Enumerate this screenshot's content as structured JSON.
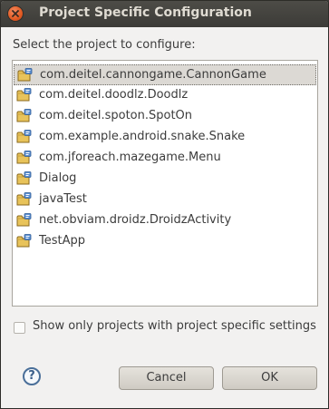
{
  "window": {
    "title": "Project Specific Configuration"
  },
  "prompt": "Select the project to configure:",
  "projects": [
    {
      "name": "com.deitel.cannongame.CannonGame",
      "selected": true
    },
    {
      "name": "com.deitel.doodlz.Doodlz",
      "selected": false
    },
    {
      "name": "com.deitel.spoton.SpotOn",
      "selected": false
    },
    {
      "name": "com.example.android.snake.Snake",
      "selected": false
    },
    {
      "name": "com.jforeach.mazegame.Menu",
      "selected": false
    },
    {
      "name": "Dialog",
      "selected": false
    },
    {
      "name": "javaTest",
      "selected": false
    },
    {
      "name": "net.obviam.droidz.DroidzActivity",
      "selected": false
    },
    {
      "name": "TestApp",
      "selected": false
    }
  ],
  "filter": {
    "label": "Show only projects with project specific settings",
    "checked": false
  },
  "buttons": {
    "help_glyph": "?",
    "cancel": "Cancel",
    "ok": "OK"
  },
  "icons": {
    "close": "close-icon",
    "project": "java-project-folder-icon",
    "help": "help-icon"
  },
  "colors": {
    "titlebar": "#3c3b37",
    "close_button": "#e15a22",
    "selection": "#dcd9d4"
  }
}
